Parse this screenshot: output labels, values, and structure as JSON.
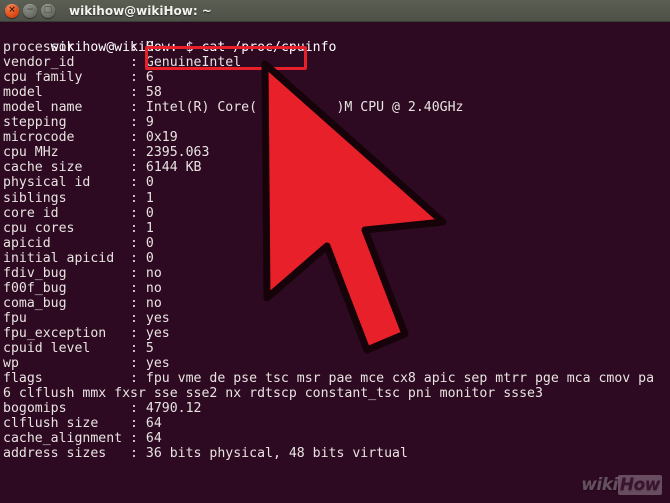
{
  "window": {
    "title": "wikihow@wikiHow: ~",
    "buttons": [
      {
        "name": "close",
        "glyph": "×",
        "color": "#df4a16"
      },
      {
        "name": "minimize",
        "glyph": "−",
        "color": "#6d7067"
      },
      {
        "name": "maximize",
        "glyph": "□",
        "color": "#6d7067"
      }
    ]
  },
  "theme": {
    "terminal_bg": "#2d0922",
    "terminal_fg": "#e8e4e0",
    "titlebar_bg": "#54574c",
    "highlight_red": "#e8202a",
    "cursor_red": "#e8202a"
  },
  "terminal": {
    "prompt": "wikihow@wikiHow:~$",
    "command": "cat /proc/cpuinfo",
    "prompt_line": "wikihow@wikiHow:~$ cat /proc/cpuinfo",
    "lines": [
      "processor       : 0",
      "vendor_id       : GenuineIntel",
      "cpu family      : 6",
      "model           : 58",
      "model name      : Intel(R) Core(          )M CPU @ 2.40GHz",
      "stepping        : 9",
      "microcode       : 0x19",
      "cpu MHz         : 2395.063",
      "cache size      : 6144 KB",
      "physical id     : 0",
      "siblings        : 1",
      "core id         : 0",
      "cpu cores       : 1",
      "apicid          : 0",
      "initial apicid  : 0",
      "fdiv_bug        : no",
      "f00f_bug        : no",
      "coma_bug        : no",
      "fpu             : yes",
      "fpu_exception   : yes",
      "cpuid level     : 5",
      "wp              : yes",
      "flags           : fpu vme de pse tsc msr pae mce cx8 apic sep mtrr pge mca cmov pa",
      "6 clflush mmx fxsr sse sse2 nx rdtscp constant_tsc pni monitor ssse3",
      "bogomips        : 4790.12",
      "clflush size    : 64",
      "cache_alignment : 64",
      "address sizes   : 36 bits physical, 48 bits virtual"
    ]
  },
  "annotations": {
    "highlight_target": "cat /proc/cpuinfo",
    "cursor_label": "red-arrow-pointer"
  },
  "watermark": {
    "prefix": "wiki",
    "suffix": "How"
  }
}
